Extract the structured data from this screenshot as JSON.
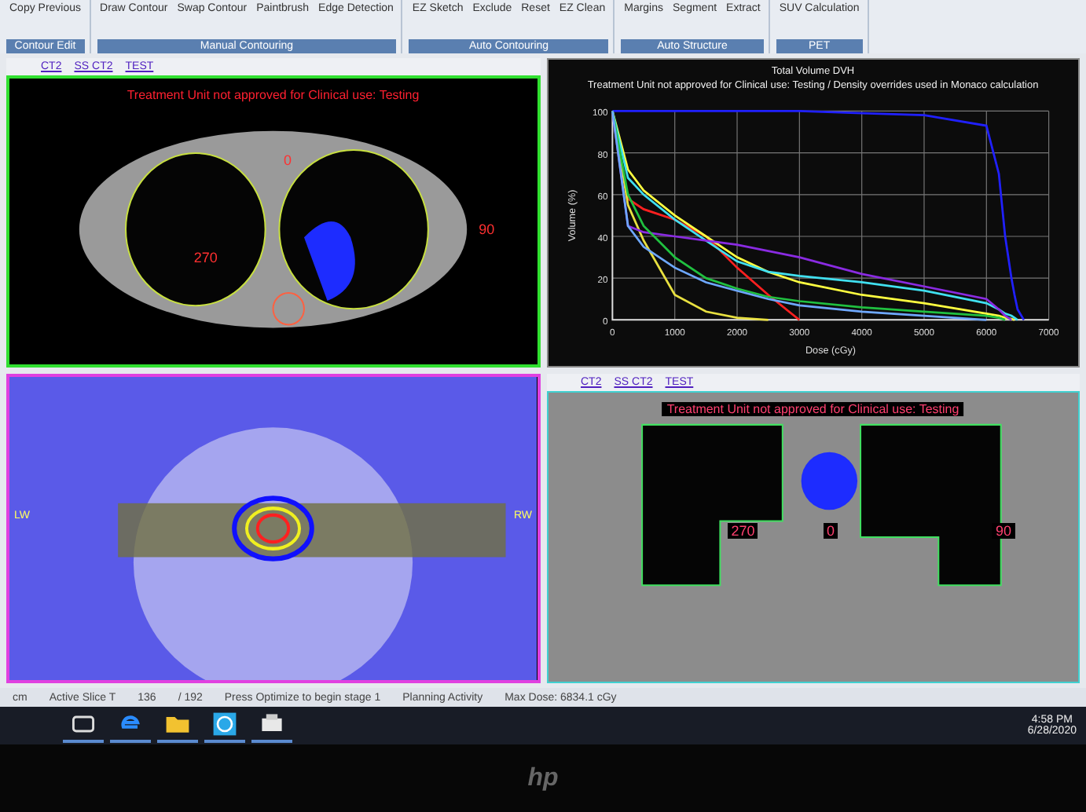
{
  "toolbar": {
    "groups": [
      {
        "label": "Contour Edit",
        "items": [
          "Copy Previous"
        ]
      },
      {
        "label": "Manual Contouring",
        "items": [
          "Draw Contour",
          "Swap Contour",
          "Paintbrush",
          "Edge Detection"
        ]
      },
      {
        "label": "Auto Contouring",
        "items": [
          "EZ Sketch",
          "Exclude",
          "Reset",
          "EZ Clean"
        ]
      },
      {
        "label": "Auto Structure",
        "items": [
          "Margins",
          "Segment",
          "Extract"
        ]
      },
      {
        "label": "PET",
        "items": [
          "SUV Calculation"
        ]
      }
    ]
  },
  "views": [
    {
      "kind": "axial",
      "tabs": [
        "CT2",
        "SS CT2",
        "TEST"
      ],
      "warning": "Treatment Unit not approved for Clinical use: Testing",
      "angles": [
        "270",
        "0",
        "90"
      ]
    },
    {
      "kind": "chart",
      "title": "Total Volume DVH",
      "subtitle": "Treatment Unit not approved for Clinical use: Testing / Density overrides used in Monaco calculation",
      "chart_data": {
        "type": "line",
        "xlabel": "Dose (cGy)",
        "ylabel": "Volume (%)",
        "grid": true,
        "x": [
          0,
          250,
          500,
          1000,
          1500,
          2000,
          2500,
          3000,
          4000,
          5000,
          6000,
          6200,
          6300,
          6400,
          6450,
          6500,
          6600
        ],
        "xlim": [
          0,
          7000
        ],
        "ylim": [
          0,
          100
        ],
        "xticks": [
          0,
          1000,
          2000,
          3000,
          4000,
          5000,
          6000,
          7000
        ],
        "yticks": [
          0,
          20,
          40,
          60,
          80,
          100
        ],
        "series": [
          {
            "color": "#2020ff",
            "values": [
              100,
              100,
              100,
              100,
              100,
              100,
              100,
              100,
              99,
              98,
              93,
              70,
              40,
              20,
              12,
              5,
              0
            ]
          },
          {
            "color": "#ff2020",
            "values": [
              100,
              58,
              53,
              48,
              40,
              25,
              12,
              0,
              null,
              null,
              null,
              null,
              null,
              null,
              null,
              null,
              null
            ]
          },
          {
            "color": "#e8e040",
            "values": [
              100,
              55,
              38,
              12,
              4,
              1,
              0,
              null,
              null,
              null,
              null,
              null,
              null,
              null,
              null,
              null,
              null
            ]
          },
          {
            "color": "#ffff40",
            "values": [
              100,
              72,
              62,
              50,
              40,
              30,
              23,
              18,
              12,
              8,
              3,
              2,
              1,
              0.5,
              0,
              null,
              null
            ]
          },
          {
            "color": "#40e0f0",
            "values": [
              100,
              68,
              60,
              48,
              38,
              28,
              23,
              21,
              18,
              14,
              8,
              5,
              3,
              2,
              1,
              0,
              null
            ]
          },
          {
            "color": "#8a2be2",
            "values": [
              100,
              45,
              42,
              40,
              38,
              36,
              33,
              30,
              22,
              16,
              10,
              5,
              2,
              0,
              null,
              null,
              null
            ]
          },
          {
            "color": "#20c040",
            "values": [
              100,
              60,
              45,
              30,
              20,
              15,
              11,
              9,
              6,
              4,
              2,
              1,
              0,
              null,
              null,
              null,
              null
            ]
          },
          {
            "color": "#6ea8ff",
            "values": [
              100,
              45,
              35,
              25,
              18,
              14,
              10,
              7,
              4,
              2,
              0,
              null,
              null,
              null,
              null,
              null,
              null
            ]
          }
        ]
      }
    },
    {
      "kind": "coronal-dose",
      "sides": [
        "LW",
        "RW"
      ]
    },
    {
      "kind": "coronal",
      "tabs": [
        "CT2",
        "SS CT2",
        "TEST"
      ],
      "warning": "Treatment Unit not approved for Clinical use: Testing",
      "angles": [
        "270",
        "0",
        "90"
      ]
    }
  ],
  "status_bar": [
    "cm",
    "Active Slice T",
    "136",
    "/ 192",
    "Press Optimize to begin stage 1",
    "Planning Activity",
    "Max Dose: 6834.1 cGy"
  ],
  "taskbar": {
    "apps": [
      {
        "kind": "task-view"
      },
      {
        "kind": "browser"
      },
      {
        "kind": "folder"
      },
      {
        "kind": "planning"
      },
      {
        "kind": "printer"
      }
    ],
    "time": "4:58 PM",
    "date": "6/28/2020"
  },
  "bezel": {
    "logo": "hp"
  }
}
